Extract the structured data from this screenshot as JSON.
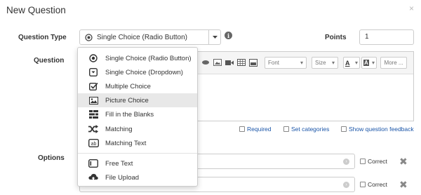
{
  "dialog": {
    "title": "New Question",
    "close_symbol": "×"
  },
  "question_type": {
    "label": "Question Type",
    "selected": "Single Choice (Radio Button)"
  },
  "points": {
    "label": "Points",
    "value": "1"
  },
  "question": {
    "label": "Question"
  },
  "toolbar": {
    "font_label": "Font",
    "size_label": "Size",
    "more_label": "More ..."
  },
  "checkboxes": {
    "required": "Required",
    "categories": "Set categories",
    "feedback": "Show question feedback"
  },
  "options": {
    "label": "Options",
    "correct_label": "Correct",
    "remove_symbol": "✖"
  },
  "dropdown": {
    "items": [
      {
        "label": "Single Choice (Radio Button)",
        "icon": "radio-button-icon"
      },
      {
        "label": "Single Choice (Dropdown)",
        "icon": "dropdown-icon"
      },
      {
        "label": "Multiple Choice",
        "icon": "checkbox-icon"
      },
      {
        "label": "Picture Choice",
        "icon": "image-icon",
        "highlighted": true
      },
      {
        "label": "Fill in the Blanks",
        "icon": "fill-blanks-icon"
      },
      {
        "label": "Matching",
        "icon": "shuffle-icon"
      },
      {
        "label": "Matching Text",
        "icon": "abc-box-icon"
      },
      {
        "label": "Free Text",
        "icon": "text-box-icon"
      },
      {
        "label": "File Upload",
        "icon": "cloud-upload-icon"
      }
    ]
  },
  "colors": {
    "link": "#1a55a8",
    "menu_hover": "#e8e8e8",
    "border": "#cccccc"
  }
}
